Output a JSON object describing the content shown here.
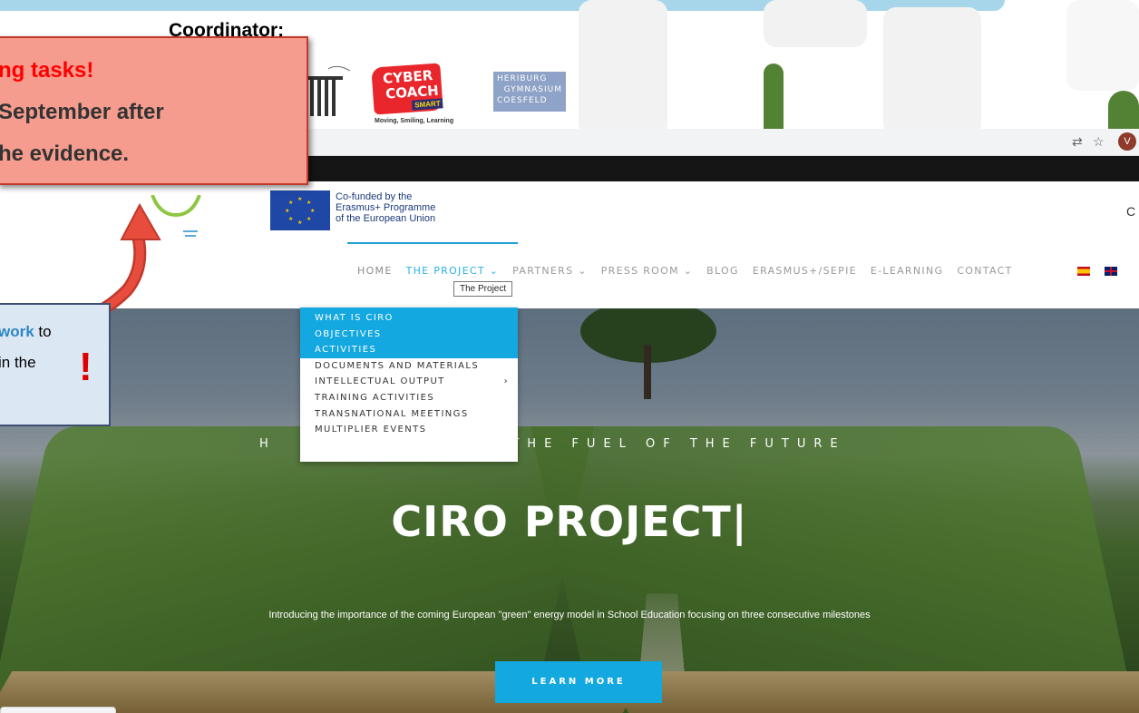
{
  "slide": {
    "coordinator_label": "Coordinator:",
    "callout_red": {
      "line1": "ng tasks!",
      "line2": "September after",
      "line3": "he evidence."
    },
    "callout_blue": {
      "line1_keyword": "work",
      "line1_rest": " to",
      "line2": "in the",
      "mark": "!"
    },
    "partner_logos": {
      "cyber_line1": "CYBER",
      "cyber_line2": "COACH",
      "cyber_smart": "SMART",
      "cyber_sub": "Moving, Smiling, Learning",
      "gym_line1": "HERIBURG",
      "gym_line2": "GYMNASIUM",
      "gym_line3": "COESFELD"
    }
  },
  "browser": {
    "icons": [
      "translate-icon",
      "star-icon"
    ],
    "avatar_letter": "V"
  },
  "site": {
    "eu_text": [
      "Co-funded by the",
      "Erasmus+ Programme",
      "of the European Union"
    ],
    "nav": [
      "HOME",
      "THE PROJECT ⌄",
      "PARTNERS ⌄",
      "PRESS ROOM ⌄",
      "BLOG",
      "ERASMUS+/SEPIE",
      "E-LEARNING",
      "CONTACT"
    ],
    "tooltip": "The Project",
    "dropdown": [
      {
        "label": "WHAT IS CIRO",
        "highlighted": true
      },
      {
        "label": "OBJECTIVES",
        "highlighted": true
      },
      {
        "label": "ACTIVITIES",
        "highlighted": true
      },
      {
        "label": "DOCUMENTS AND MATERIALS",
        "highlighted": false
      },
      {
        "label": "INTELLECTUAL OUTPUT",
        "highlighted": false,
        "submenu": "›"
      },
      {
        "label": "TRAINING ACTIVITIES",
        "highlighted": false
      },
      {
        "label": "TRANSNATIONAL MEETINGS",
        "highlighted": false
      },
      {
        "label": "MULTIPLIER EVENTS",
        "highlighted": false
      }
    ],
    "hero": {
      "tagline_left": "H",
      "tagline_right": "E THE FUEL OF THE FUTURE",
      "title": "CIRO PROJECT|",
      "subtitle": "Introducing the importance of the coming European \"green\" energy model in School Education focusing on three consecutive milestones",
      "cta": "LEARN MORE"
    },
    "search_glyph": "C"
  },
  "colors": {
    "accent": "#14a8e0",
    "callout_red_bg": "#f69c8e",
    "callout_red_text": "#ff0000",
    "callout_blue_bg": "#dbe7f3",
    "green_shape": "#548235"
  }
}
